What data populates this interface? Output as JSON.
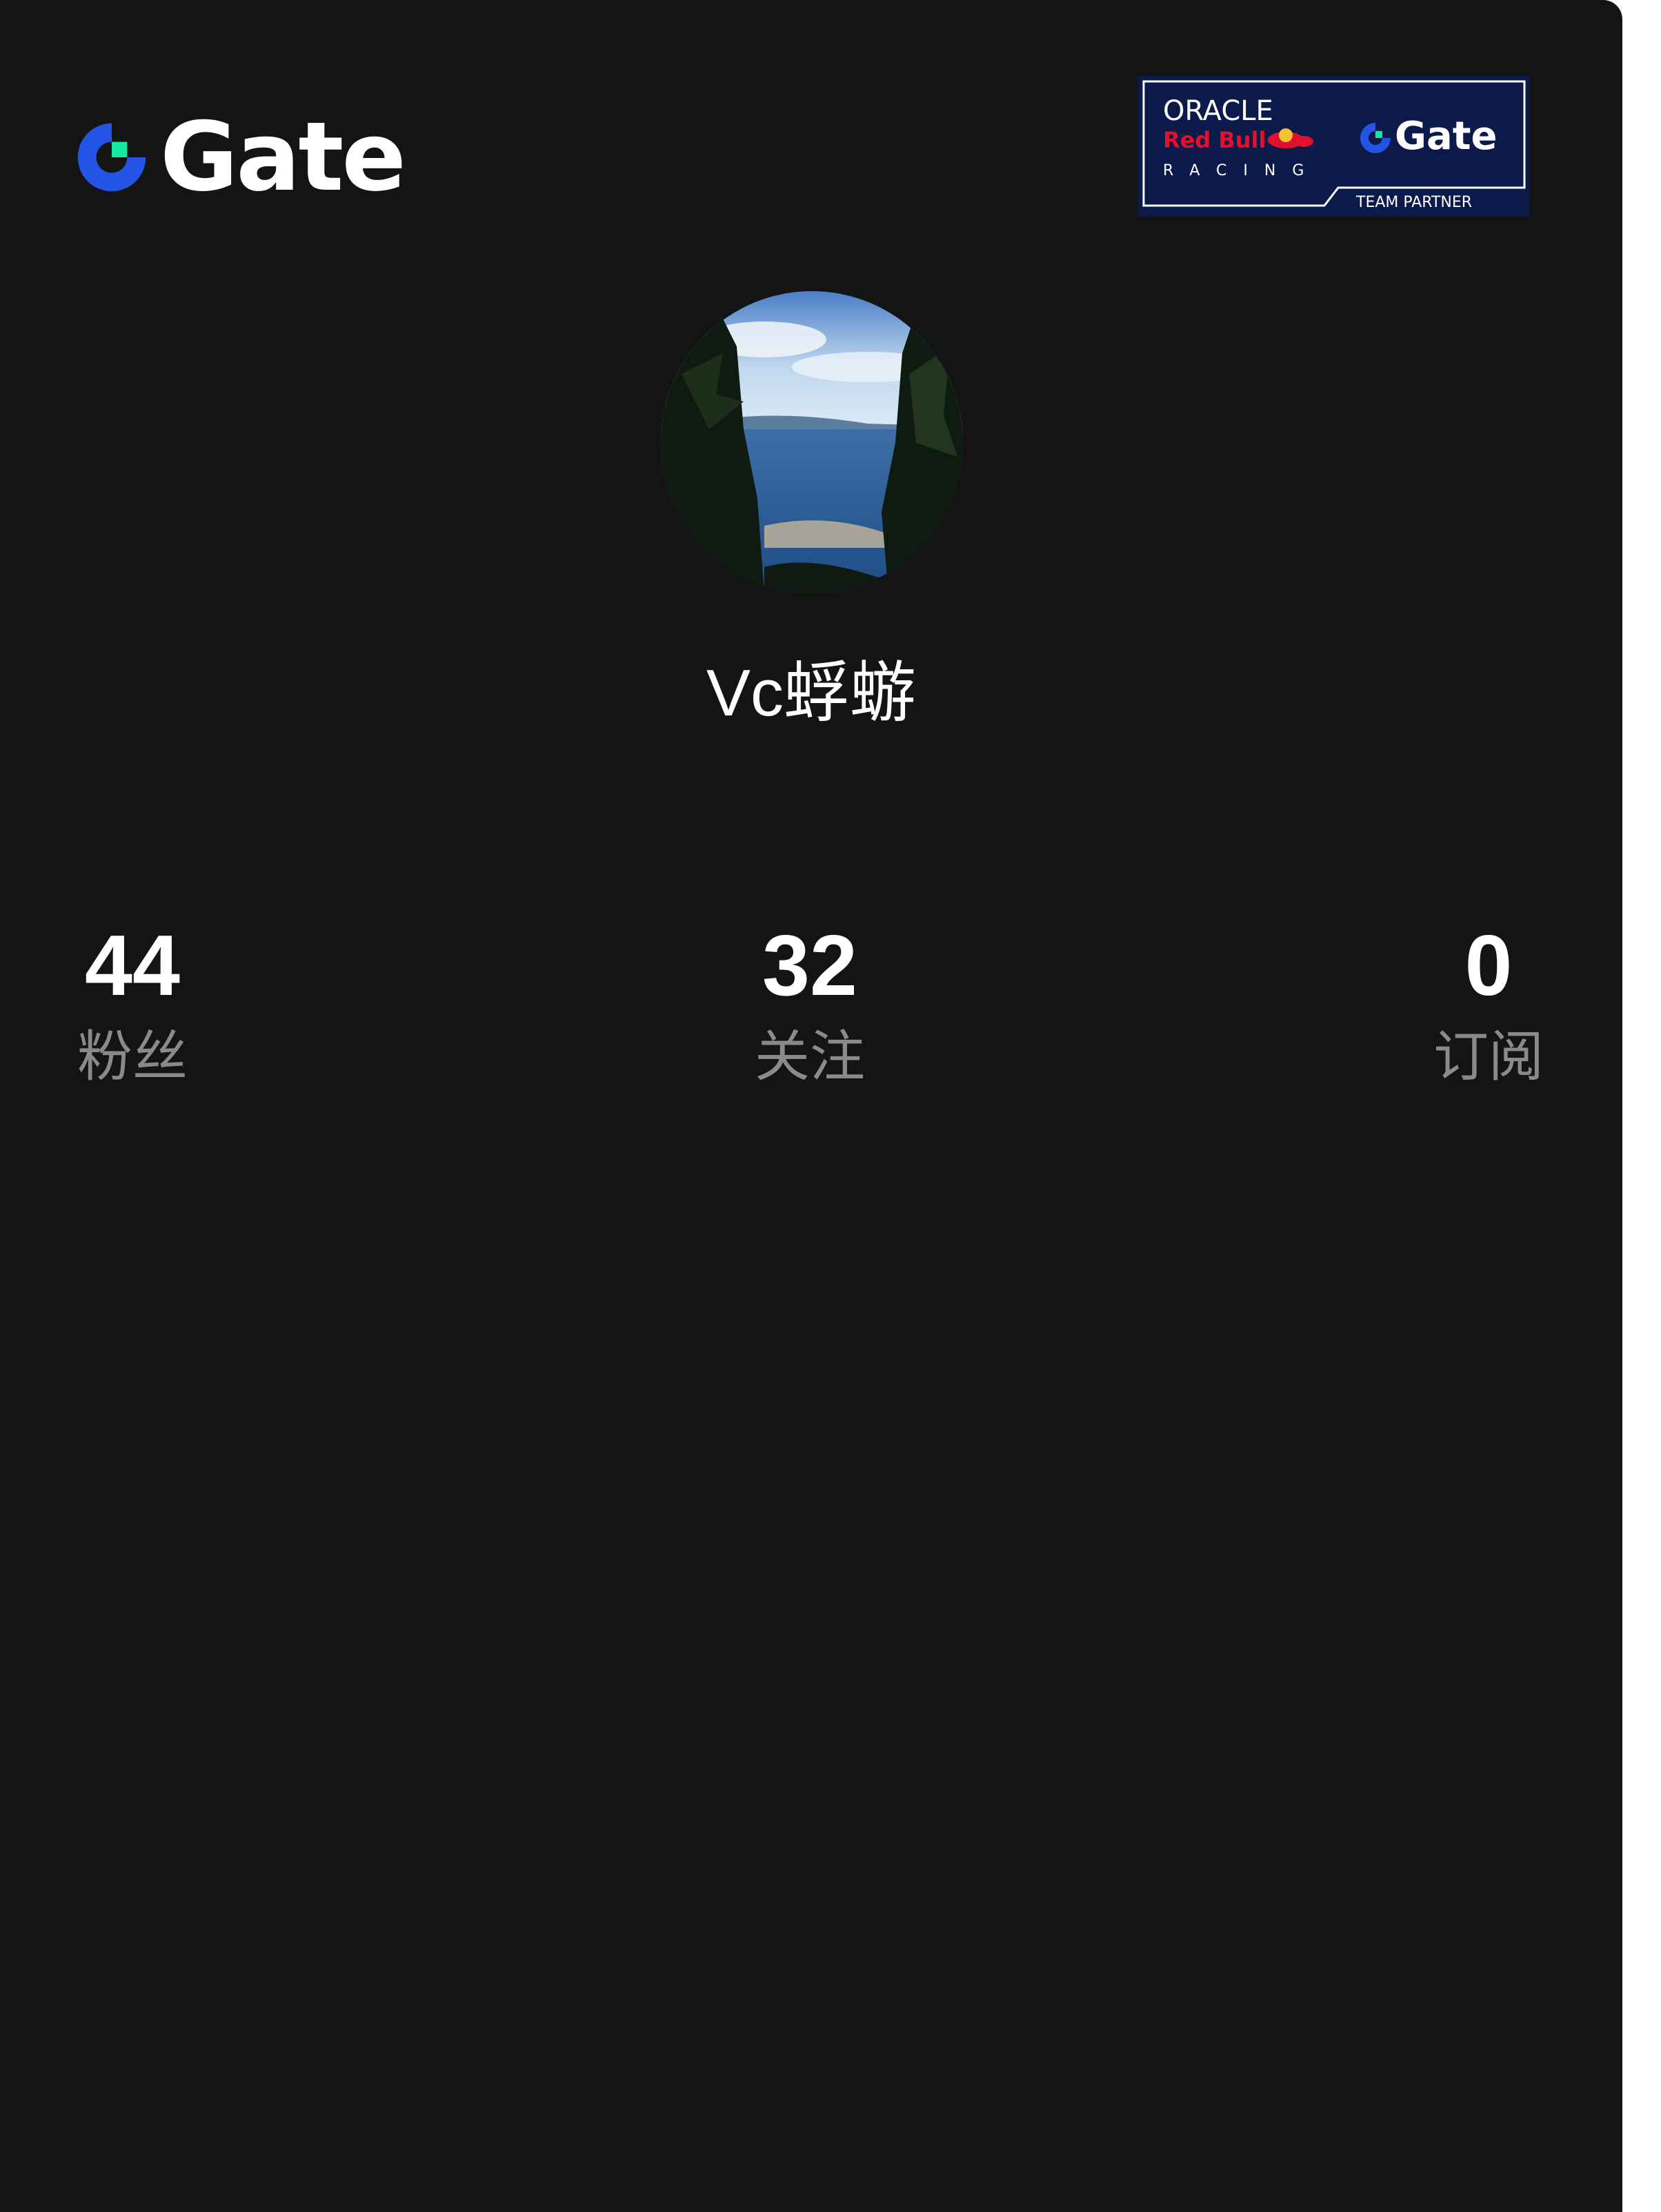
{
  "header": {
    "logo_text": "Gate",
    "partner_badge": {
      "line1": "ORACLE",
      "line2": "Red Bull",
      "line3": "RACING",
      "brand": "Gate",
      "tag": "TEAM PARTNER"
    }
  },
  "profile": {
    "username": "Vc蜉蝣"
  },
  "stats": [
    {
      "value": "44",
      "label": "粉丝"
    },
    {
      "value": "32",
      "label": "关注"
    },
    {
      "value": "0",
      "label": "订阅"
    }
  ],
  "colors": {
    "background": "#141414",
    "brand_blue": "#2354E6",
    "brand_green": "#17E6A1",
    "label_gray": "#8a8a8a",
    "badge_navy": "#0B1A4A"
  }
}
